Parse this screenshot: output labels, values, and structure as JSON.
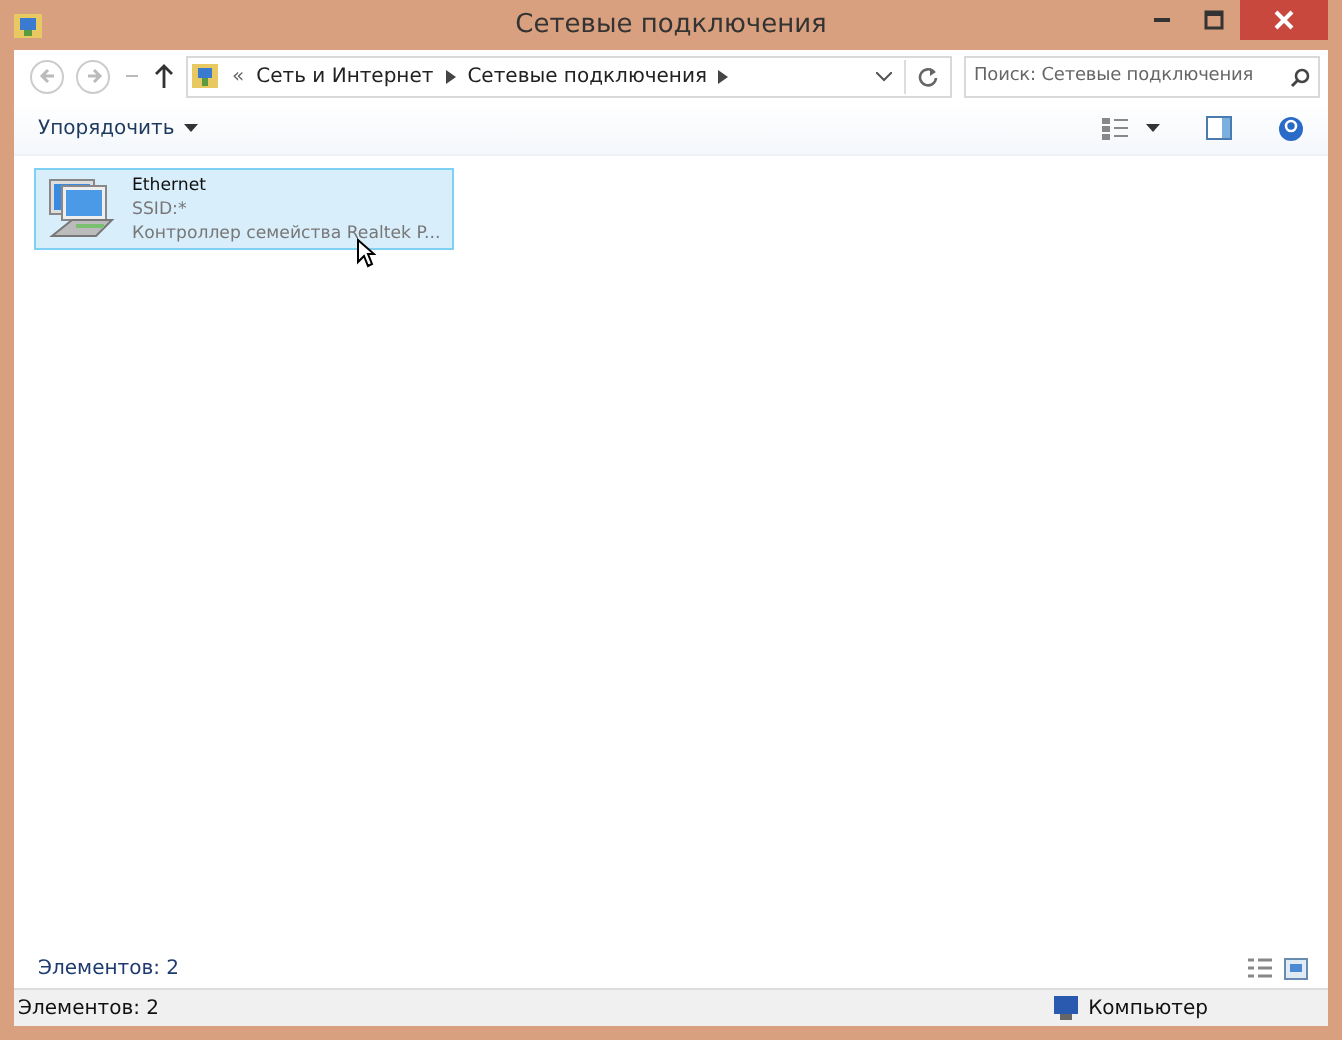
{
  "window": {
    "title": "Сетевые подключения"
  },
  "address_bar": {
    "prefix": "«",
    "crumbs": [
      "Сеть и Интернет",
      "Сетевые подключения"
    ]
  },
  "search": {
    "placeholder": "Поиск: Сетевые подключения"
  },
  "toolbar": {
    "organize": "Упорядочить"
  },
  "items": [
    {
      "name": "Ethernet",
      "ssid": "SSID:*",
      "adapter": "Контроллер семейства Realtek P...",
      "selected": true
    }
  ],
  "footer": {
    "count": "Элементов: 2"
  },
  "status_bar": {
    "count": "Элементов: 2",
    "zone": "Компьютер"
  }
}
